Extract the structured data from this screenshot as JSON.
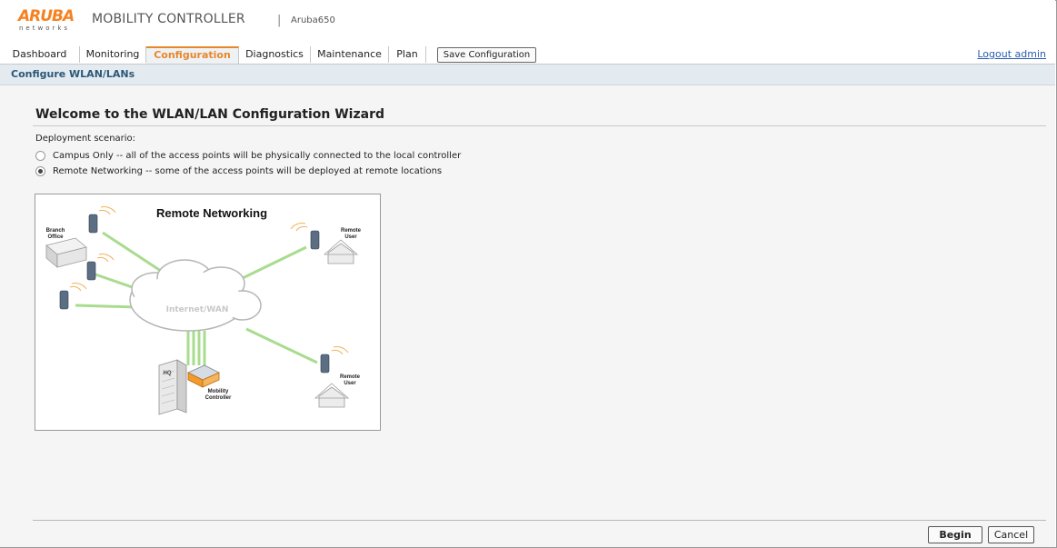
{
  "header": {
    "logo_word": "ARUBA",
    "logo_sub": "networks",
    "title": "MOBILITY CONTROLLER",
    "separator": "|",
    "hostname": "Aruba650"
  },
  "nav": {
    "tabs": [
      {
        "label": "Dashboard",
        "active": false
      },
      {
        "label": "Monitoring",
        "active": false
      },
      {
        "label": "Configuration",
        "active": true
      },
      {
        "label": "Diagnostics",
        "active": false
      },
      {
        "label": "Maintenance",
        "active": false
      },
      {
        "label": "Plan",
        "active": false
      }
    ],
    "save_label": "Save Configuration",
    "logout_label": "Logout admin"
  },
  "subbar": {
    "title": "Configure WLAN/LANs"
  },
  "wizard": {
    "title": "Welcome to the WLAN/LAN Configuration Wizard",
    "scenario_label": "Deployment scenario:",
    "options": [
      {
        "label": "Campus Only -- all of the access points will be physically connected to the local controller",
        "selected": false
      },
      {
        "label": "Remote Networking -- some of the access points will be deployed at remote locations",
        "selected": true
      }
    ],
    "diagram": {
      "title": "Remote Networking",
      "cloud_label": "Internet/WAN",
      "branch_label_1": "Branch",
      "branch_label_2": "Office",
      "remote_label_1": "Remote",
      "remote_label_2": "User",
      "hq_label": "HQ",
      "controller_label_1": "Mobility",
      "controller_label_2": "Controller"
    }
  },
  "footer": {
    "begin_label": "Begin",
    "cancel_label": "Cancel"
  },
  "colors": {
    "brand_orange": "#f58220",
    "active_tab": "#e8872a",
    "link_blue": "#2a5db0",
    "subbar_bg": "#e3ebf1",
    "link_green": "#9fd486"
  }
}
